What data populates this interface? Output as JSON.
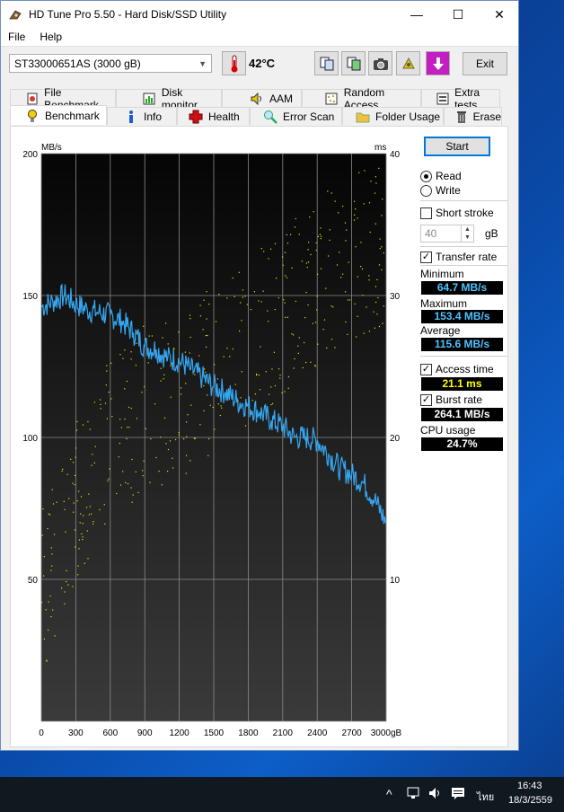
{
  "window": {
    "title": "HD Tune Pro 5.50 - Hard Disk/SSD Utility",
    "minimize": "—",
    "maximize": "☐",
    "close": "✕"
  },
  "menu": {
    "file": "File",
    "help": "Help"
  },
  "toolbar": {
    "drive": "ST33000651AS (3000 gB)",
    "temperature": "42°C",
    "exit": "Exit"
  },
  "tabs_top": [
    "File Benchmark",
    "Disk monitor",
    "AAM",
    "Random Access",
    "Extra tests"
  ],
  "tabs_bottom": [
    "Benchmark",
    "Info",
    "Health",
    "Error Scan",
    "Folder Usage",
    "Erase"
  ],
  "controls": {
    "start": "Start",
    "read": "Read",
    "write": "Write",
    "short_stroke": "Short stroke",
    "stroke_value": "40",
    "stroke_unit": "gB",
    "transfer_rate": "Transfer rate",
    "minimum_label": "Minimum",
    "minimum_value": "64.7 MB/s",
    "maximum_label": "Maximum",
    "maximum_value": "153.4 MB/s",
    "average_label": "Average",
    "average_value": "115.6 MB/s",
    "access_time": "Access time",
    "access_value": "21.1 ms",
    "burst_rate": "Burst rate",
    "burst_value": "264.1 MB/s",
    "cpu_label": "CPU usage",
    "cpu_value": "24.7%"
  },
  "colors": {
    "transfer_line": "#35a7f2",
    "access_dots": "#e6e600",
    "min_color": "#4fc3ff",
    "access_color": "#ffff00"
  },
  "chart_data": {
    "type": "line",
    "ylabel": "MB/s",
    "y2label": "ms",
    "ylim": [
      0,
      200
    ],
    "y2lim": [
      0,
      40
    ],
    "xlim": [
      0,
      3000
    ],
    "xticks": [
      "0",
      "300",
      "600",
      "900",
      "1200",
      "1500",
      "1800",
      "2100",
      "2400",
      "2700",
      "3000gB"
    ],
    "yticks": [
      "200",
      "150",
      "100",
      "50"
    ],
    "y2ticks": [
      "40",
      "30",
      "20",
      "10"
    ],
    "series": [
      {
        "x": [
          0,
          100,
          200,
          300,
          400,
          500,
          600,
          700,
          800,
          900,
          1000,
          1100,
          1200,
          1300,
          1400,
          1500,
          1600,
          1700,
          1800,
          1900,
          2000,
          2100,
          2200,
          2300,
          2400,
          2500,
          2600,
          2700,
          2800,
          2900,
          3000
        ],
        "values": [
          146,
          148,
          150,
          147,
          145,
          144,
          143,
          141,
          137,
          132,
          131,
          128,
          127,
          124,
          121,
          118,
          116,
          113,
          111,
          109,
          106,
          104,
          100,
          100,
          99,
          94,
          89,
          87,
          84,
          78,
          70
        ]
      },
      {
        "x": [
          0,
          300,
          600,
          900,
          1200,
          1500,
          1800,
          2100,
          2400,
          2700,
          3000
        ],
        "values": [
          9,
          16,
          20,
          22,
          23,
          25,
          27,
          29,
          31,
          33,
          34
        ]
      }
    ]
  },
  "taskbar": {
    "time": "16:43",
    "date": "18/3/2559",
    "lang": "ไทย",
    "chevron": "^"
  }
}
